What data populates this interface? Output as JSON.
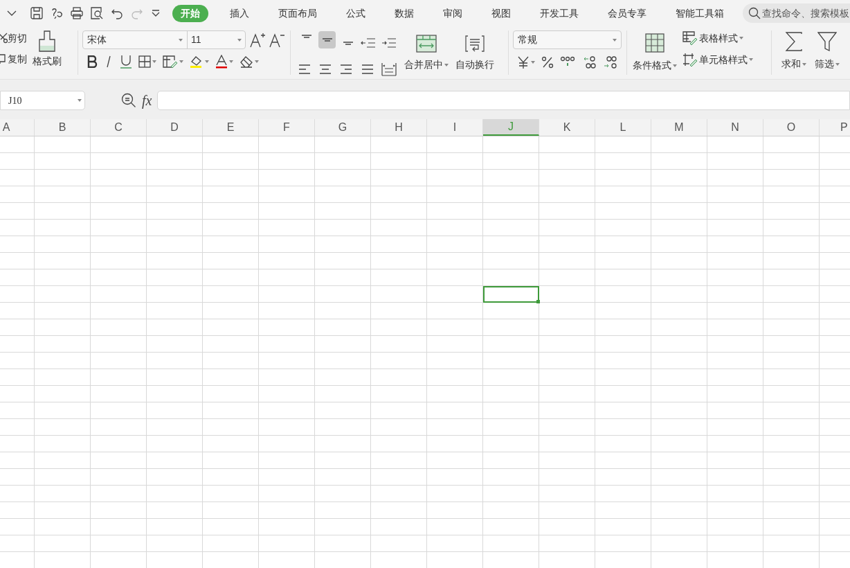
{
  "menu_tabs": [
    {
      "label": "开始",
      "selected": true
    },
    {
      "label": "插入",
      "selected": false
    },
    {
      "label": "页面布局",
      "selected": false
    },
    {
      "label": "公式",
      "selected": false
    },
    {
      "label": "数据",
      "selected": false
    },
    {
      "label": "审阅",
      "selected": false
    },
    {
      "label": "视图",
      "selected": false
    },
    {
      "label": "开发工具",
      "selected": false
    },
    {
      "label": "会员专享",
      "selected": false
    },
    {
      "label": "智能工具箱",
      "selected": false
    }
  ],
  "search": {
    "placeholder": "查找命令、搜索模板"
  },
  "clipboard": {
    "cut": "剪切",
    "copy": "复制",
    "format_painter": "格式刷"
  },
  "font": {
    "family": "宋体",
    "size": "11"
  },
  "vertical_align": [
    {
      "selected": false
    },
    {
      "selected": true
    },
    {
      "selected": false
    }
  ],
  "alignment": {
    "merge": "合并居中",
    "wrap": "自动换行"
  },
  "number_format": "常规",
  "styles": {
    "conditional": "条件格式",
    "table_style": "表格样式",
    "cell_style": "单元格样式"
  },
  "editing": {
    "sum": "求和",
    "filter": "筛选"
  },
  "name_box": "J10",
  "formula": {
    "label": "fx"
  },
  "columns": [
    {
      "label": "A",
      "selected": false
    },
    {
      "label": "B",
      "selected": false
    },
    {
      "label": "C",
      "selected": false
    },
    {
      "label": "D",
      "selected": false
    },
    {
      "label": "E",
      "selected": false
    },
    {
      "label": "F",
      "selected": false
    },
    {
      "label": "G",
      "selected": false
    },
    {
      "label": "H",
      "selected": false
    },
    {
      "label": "I",
      "selected": false
    },
    {
      "label": "J",
      "selected": true
    },
    {
      "label": "K",
      "selected": false
    },
    {
      "label": "L",
      "selected": false
    },
    {
      "label": "M",
      "selected": false
    },
    {
      "label": "N",
      "selected": false
    },
    {
      "label": "O",
      "selected": false
    },
    {
      "label": "P",
      "selected": false
    }
  ],
  "rows": [
    {
      "selected": false
    },
    {
      "selected": false
    },
    {
      "selected": false
    },
    {
      "selected": false
    },
    {
      "selected": false
    },
    {
      "selected": false
    },
    {
      "selected": false
    },
    {
      "selected": false
    },
    {
      "selected": false
    },
    {
      "selected": true
    },
    {
      "selected": false
    },
    {
      "selected": false
    },
    {
      "selected": false
    },
    {
      "selected": false
    },
    {
      "selected": false
    },
    {
      "selected": false
    },
    {
      "selected": false
    },
    {
      "selected": false
    },
    {
      "selected": false
    },
    {
      "selected": false
    },
    {
      "selected": false
    },
    {
      "selected": false
    },
    {
      "selected": false
    },
    {
      "selected": false
    },
    {
      "selected": false
    },
    {
      "selected": false
    }
  ]
}
